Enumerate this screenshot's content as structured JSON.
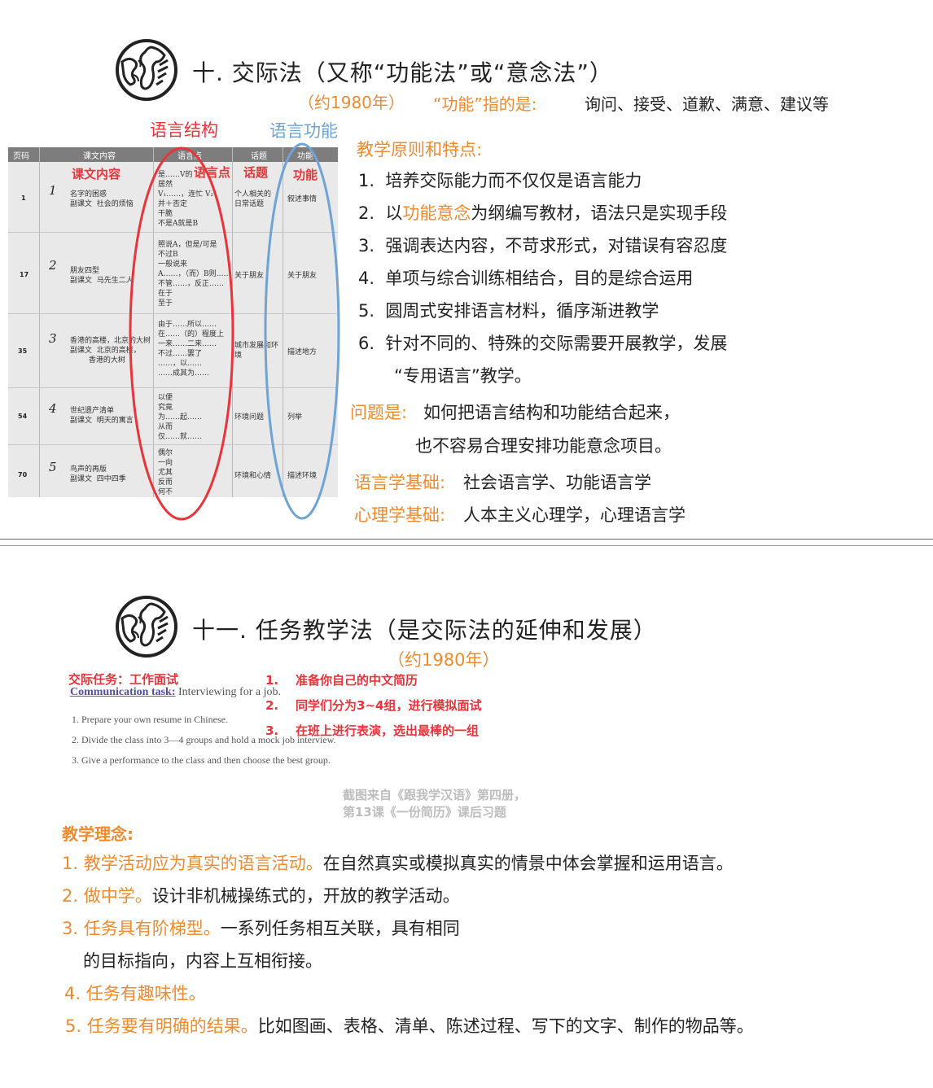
{
  "section10": {
    "title": "十.  交际法（又称“功能法”或“意念法”）",
    "year": "（约1980年）",
    "function_label": "“功能”指的是:",
    "function_text": "询问、接受、道歉、满意、建议等",
    "circle_red_label": "语言结构",
    "circle_blue_label": "语言功能",
    "principles_heading": "教学原则和特点:",
    "principles": [
      {
        "num": "1.",
        "text": "培养交际能力而不仅仅是语言能力"
      },
      {
        "num": "2.",
        "pre": "以",
        "highlight": "功能意念",
        "post": "为纲编写教材，语法只是实现手段"
      },
      {
        "num": "3.",
        "text": "强调表达内容，不苛求形式，对错误有容忍度"
      },
      {
        "num": "4.",
        "text": "单项与综合训练相结合，目的是综合运用"
      },
      {
        "num": "5.",
        "text": "圆周式安排语言材料，循序渐进教学"
      },
      {
        "num": "6.",
        "text": "针对不同的、特殊的交际需要开展教学，发展"
      },
      {
        "num": "",
        "text": "“专用语言”教学。"
      }
    ],
    "problem_label": "问题是:",
    "problem_line1": "如何把语言结构和功能结合起来，",
    "problem_line2": "也不容易合理安排功能意念项目。",
    "linguistics_label": "语言学基础:",
    "linguistics_text": "社会语言学、功能语言学",
    "psychology_label": "心理学基础:",
    "psychology_text": "人本主义心理学，心理语言学",
    "table": {
      "headers": [
        "页码",
        "课文内容",
        "语言点",
        "话题",
        "功能"
      ],
      "overlay_labels": {
        "content": "课文内容",
        "grammar": "语言点",
        "topic": "话题",
        "function": "功能"
      },
      "rows": [
        {
          "page": "1",
          "num": "1",
          "content": "名字的困惑\n副课文  社会的烦恼",
          "grammar": "是……V的\n居然\nV₁……，连忙 V₂\n并＋否定\n干脆\n不是A就是B",
          "topic": "个人相关的\n日常话题",
          "func": "叙述事情"
        },
        {
          "page": "17",
          "num": "2",
          "content": "朋友四型\n副课文  马先生二人",
          "grammar": "照说A，但是/可是\n不过B\n一般说来\nA……，（而）B则……\n不管……，反正……\n在于\n至于",
          "topic": "关于朋友",
          "func": "关于朋友"
        },
        {
          "page": "35",
          "num": "3",
          "content": "香港的高楼，北京的大树\n副课文  北京的高楼，\n        香港的大树",
          "grammar": "由于……所以……\n在……（的）程度上\n一来……二来……\n不过……罢了\n……，以……\n……成其为……",
          "topic": "城市发展和环\n境",
          "func": "描述地方"
        },
        {
          "page": "54",
          "num": "4",
          "content": "世纪遗产清单\n副课文  明天的寓言",
          "grammar": "以便\n究竟\n为……起……\n从而\n仅……就……",
          "topic": "环境问题",
          "func": "列举"
        },
        {
          "page": "70",
          "num": "5",
          "content": "鸟声的再版\n副课文  四中四季",
          "grammar": "偶尔\n一向\n尤其\n反而\n何不",
          "topic": "环境和心情",
          "func": "描述环境"
        }
      ]
    }
  },
  "section11": {
    "title": "十一.  任务教学法（是交际法的延伸和发展）",
    "year": "（约1980年）",
    "task_label_cn": "交际任务：工作面试",
    "task_label_en": "Communication task:",
    "task_label_en_rest": " Interviewing for a job.",
    "task_en": [
      "1. Prepare your own resume in Chinese.",
      "2. Divide the class into 3—4 groups and hold a mock job interview.",
      "3. Give a performance to the class and then choose the best group."
    ],
    "task_cn": [
      {
        "num": "1.",
        "text": "准备你自己的中文简历"
      },
      {
        "num": "2.",
        "text": "同学们分为3~4组，进行模拟面试"
      },
      {
        "num": "3.",
        "text": "在班上进行表演，选出最棒的一组"
      }
    ],
    "caption_line1": "截图来自《跟我学汉语》第四册，",
    "caption_line2": "第13课《一份简历》课后习题",
    "concept_heading": "教学理念:",
    "concepts": [
      {
        "lead": "1.  教学活动应为真实的语言活动。",
        "text": "在自然真实或模拟真实的情景中体会掌握和运用语言。"
      },
      {
        "lead": "2. 做中学。",
        "text": "设计非机械操练式的，开放的教学活动。"
      },
      {
        "lead": "3. 任务具有阶梯型。",
        "text": "一系列任务相互关联，具有相同"
      },
      {
        "lead": "",
        "text": "的目标指向，内容上互相衔接。"
      },
      {
        "lead": "4. 任务有趣味性。",
        "text": ""
      },
      {
        "lead": "5. 任务要有明确的结果。",
        "text": "比如图画、表格、清单、陈述过程、写下的文字、制作的物品等。"
      }
    ]
  },
  "colors": {
    "orange": "#ef8a2e",
    "red": "#e8343a",
    "blue": "#6fa3d6"
  },
  "icons": [
    "globe-icon"
  ]
}
